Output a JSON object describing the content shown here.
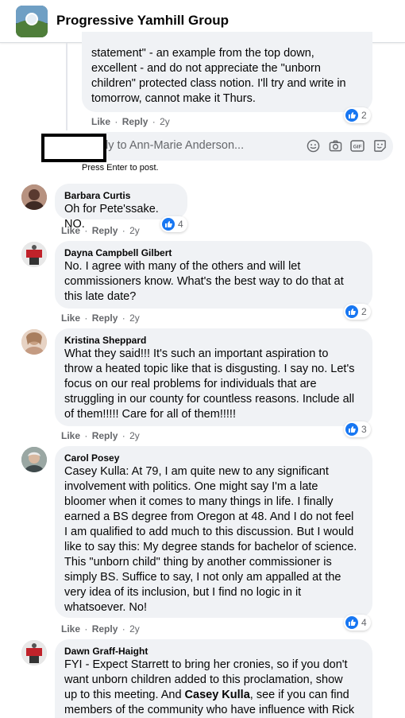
{
  "group": {
    "name": "Progressive Yamhill Group"
  },
  "actions": {
    "like": "Like",
    "reply": "Reply",
    "sep": "·"
  },
  "top_comment": {
    "lines": [
      "statement\" - an example from the top down,",
      "excellent - and do not appreciate the \"unborn",
      "children\" protected class notion. I'll try and write in",
      "tomorrow, cannot make it Thurs."
    ],
    "partial_line": "...pp..   .. .. . .  ...  .. .  ..",
    "time": "2y",
    "reactions": "2"
  },
  "reply_box": {
    "placeholder": "ly to Ann-Marie Anderson...",
    "hint": "Press Enter to post.",
    "icons": [
      "emoji-icon",
      "camera-icon",
      "gif-icon",
      "sticker-icon"
    ]
  },
  "comments": [
    {
      "author": "Barbara Curtis",
      "lines": [
        "Oh for Pete'ssake. NO."
      ],
      "time": "2y",
      "reactions": "4"
    },
    {
      "author": "Dayna Campbell Gilbert",
      "lines": [
        "No. I agree with many of the others and will let",
        "commissioners know. What's the best way to do that at",
        "this late date?"
      ],
      "time": "2y",
      "reactions": "2"
    },
    {
      "author": "Kristina Sheppard",
      "lines": [
        "What they said!!! It's such an important aspiration to",
        "throw a heated topic like that is disgusting. I say no. Let's",
        "focus on our real problems for individuals that are",
        "struggling in our county for countless reasons. Include all",
        "of them!!!!! Care for all of them!!!!!"
      ],
      "time": "2y",
      "reactions": "3"
    },
    {
      "author": "Carol Posey",
      "lines": [
        "Casey Kulla: At 79, I am quite new to any significant",
        "involvement with politics. One might say I'm a late",
        "bloomer when it comes to many things in life. I finally",
        "earned a BS degree from Oregon at 48. And I do not feel",
        "I am qualified to add much to this discussion. But I would",
        "like to say this: My degree stands for bachelor of science.",
        "This \"unborn child\" thing by another commissioner is",
        "simply BS. Suffice to say, I not only am appalled at the",
        "very idea of its inclusion, but I find no logic in it",
        "whatsoever. No!"
      ],
      "time": "2y",
      "reactions": "4"
    },
    {
      "author": "Dawn Graff-Haight",
      "lines": [
        "FYI - Expect Starrett to bring her cronies, so if you don't",
        "want unborn children added to this proclamation, show",
        "up to this meeting. And",
        "Casey Kulla",
        ", see if you can find",
        "members of the community who have influence with Rick"
      ]
    }
  ]
}
